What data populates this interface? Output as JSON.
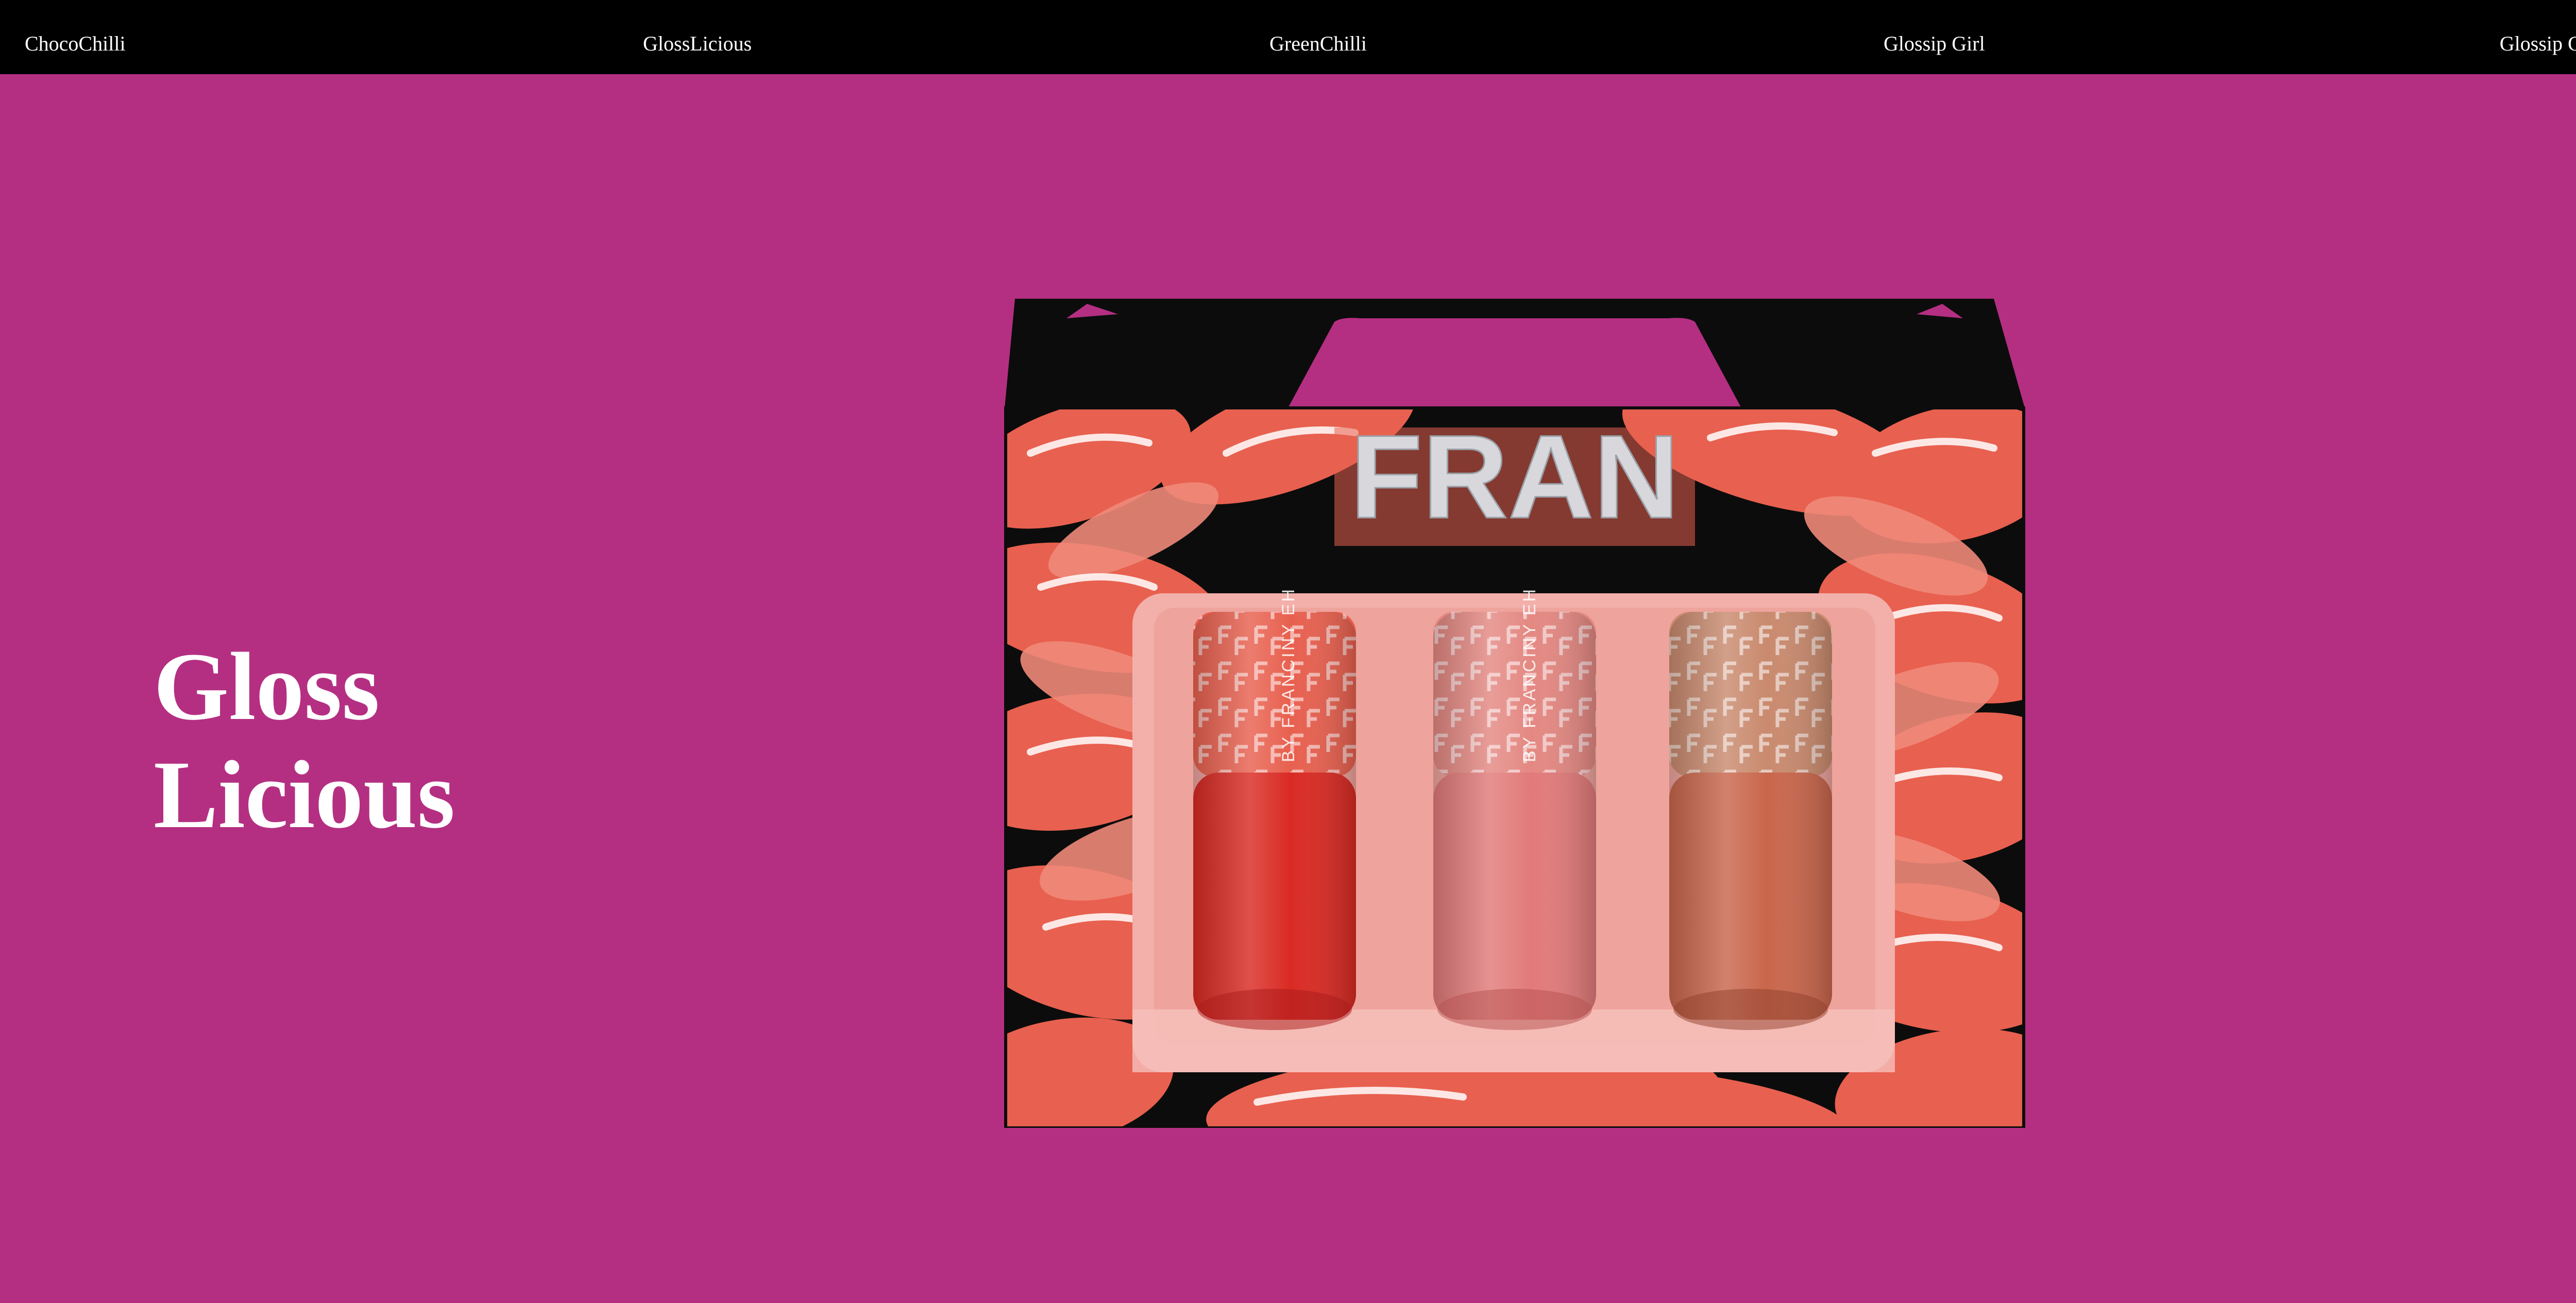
{
  "nav": {
    "items": [
      {
        "label": "ChocoChilli"
      },
      {
        "label": "GlossLicious"
      },
      {
        "label": "GreenChilli"
      },
      {
        "label": "Glossip Girl"
      },
      {
        "label": "Glossip Gold"
      }
    ]
  },
  "hero": {
    "title_line1": "Gloss",
    "title_line2": "Licious"
  },
  "product": {
    "brand_logo_text": "FRAN",
    "tube_text": "BY FRANCINY EH",
    "colors": {
      "background": "#b42f82",
      "box_black": "#0c0c0c",
      "swirl_coral": "#e8604f",
      "tray_pink": "#f3b0aa",
      "gloss_red": "#d92a23",
      "gloss_pink": "#e27a7a",
      "gloss_nude": "#c9664c"
    }
  }
}
